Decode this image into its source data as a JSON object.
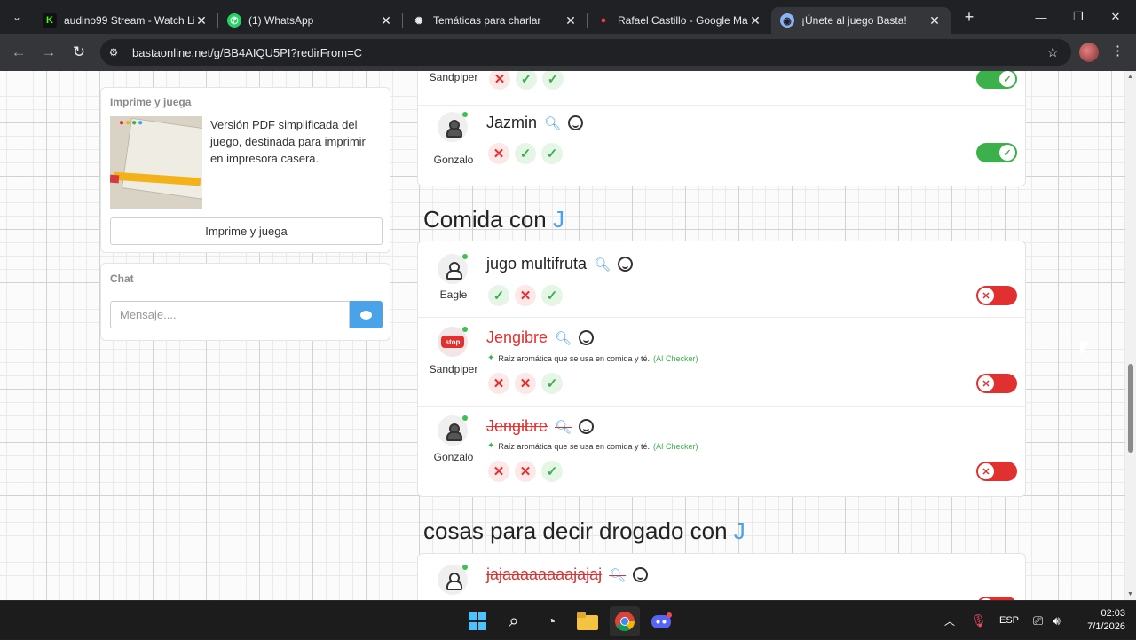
{
  "browser": {
    "tabs": [
      {
        "title": "audino99 Stream - Watch Li",
        "icon": "kick-icon",
        "color": "#53fc18"
      },
      {
        "title": "(1) WhatsApp",
        "icon": "whatsapp-icon",
        "color": "#25d366"
      },
      {
        "title": "Temáticas para charlar",
        "icon": "openai-icon",
        "color": "#e8eaed"
      },
      {
        "title": "Rafael Castillo - Google Map",
        "icon": "maps-pin-icon",
        "color": "#ea4335"
      },
      {
        "title": "¡Únete al juego Basta!",
        "icon": "basta-icon",
        "color": "#8ab4f8",
        "active": true
      }
    ],
    "url": "bastaonline.net/g/BB4AIQU5PI?redirFrom=C"
  },
  "sidebar": {
    "print_card": {
      "title": "Imprime y juega",
      "description": "Versión PDF simplificada del juego, destinada para imprimir en impresora casera.",
      "button": "Imprime y juega"
    },
    "chat": {
      "title": "Chat",
      "placeholder": "Mensaje...."
    }
  },
  "game": {
    "previous_card": {
      "rows": [
        {
          "player": "Sandpiper",
          "votes": [
            "no",
            "yes",
            "yes"
          ],
          "accepted": true
        },
        {
          "player": "Gonzalo",
          "word": "Jazmin",
          "votes": [
            "no",
            "yes",
            "yes"
          ],
          "accepted": true
        }
      ]
    },
    "categories": [
      {
        "prefix": "Comida con",
        "letter": "J",
        "answers": [
          {
            "player": "Eagle",
            "word": "jugo multifruta",
            "style": "normal",
            "votes": [
              "yes",
              "no",
              "yes"
            ],
            "accepted": false
          },
          {
            "player": "Sandpiper",
            "word": "Jengibre",
            "style": "red",
            "hint": "Raíz aromática que se usa en comida y té.",
            "hint_source": "(AI Checker)",
            "votes": [
              "no",
              "no",
              "yes"
            ],
            "accepted": false,
            "stop": true
          },
          {
            "player": "Gonzalo",
            "word": "Jengibre",
            "style": "red-strike",
            "hint": "Raíz aromática que se usa en comida y té.",
            "hint_source": "(AI Checker)",
            "votes": [
              "no",
              "no",
              "yes"
            ],
            "accepted": false
          }
        ]
      },
      {
        "prefix": "cosas para decir drogado con",
        "letter": "J",
        "answers": [
          {
            "word": "jajaaaaaaaajajaj",
            "style": "red-strike"
          }
        ]
      }
    ],
    "stop_badge": "stop"
  },
  "taskbar": {
    "language": "ESP",
    "time": "02:03",
    "date": "7/1/2026"
  }
}
